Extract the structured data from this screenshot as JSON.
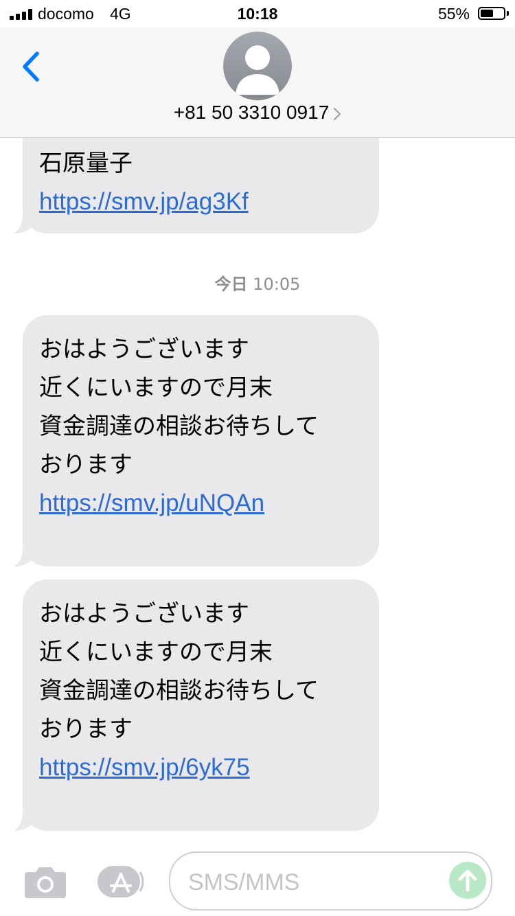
{
  "status_bar": {
    "carrier": "docomo",
    "network": "4G",
    "time": "10:18",
    "battery_percent": "55%",
    "battery_level": 0.55
  },
  "header": {
    "contact": "+81 50 3310 0917",
    "back_icon": "chevron-left-icon",
    "avatar_icon": "person-icon"
  },
  "messages": [
    {
      "text": "石原量子",
      "link": "https://smv.jp/ag3Kf"
    },
    {
      "text": "おはようございます\n近くにいますので月末\n資金調達の相談お待ちして\nおります\n ",
      "link": "https://smv.jp/uNQAn"
    },
    {
      "text": "おはようございます\n近くにいますので月末\n資金調達の相談お待ちして\nおります\n ",
      "link": "https://smv.jp/6yk75"
    }
  ],
  "timestamp": {
    "day": "今日",
    "time": "10:05"
  },
  "input": {
    "placeholder": "SMS/MMS"
  },
  "colors": {
    "bubble_bg": "#e9e9eb",
    "link": "#2c6bd6",
    "accent": "#007aff",
    "send_button": "#b8e8c6"
  }
}
